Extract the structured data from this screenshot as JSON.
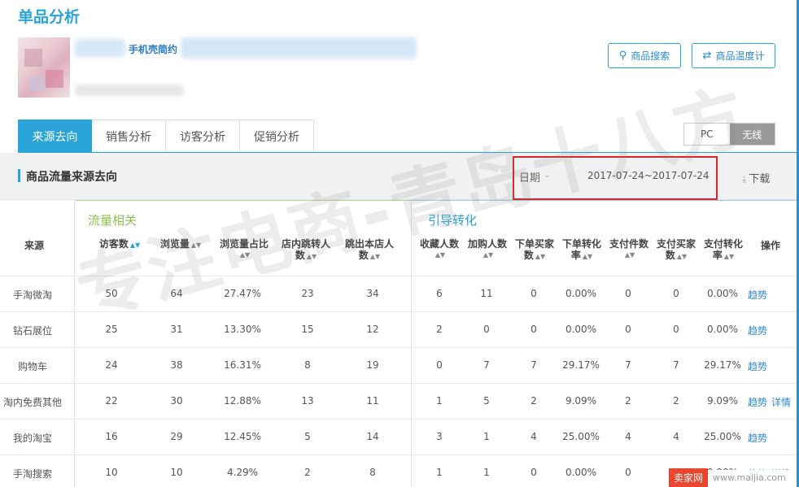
{
  "page": {
    "title": "单品分析"
  },
  "product": {
    "name": "手机壳简约"
  },
  "buttons": {
    "search": "商品搜索",
    "thermometer": "商品温度计"
  },
  "tabs": [
    "来源去向",
    "销售分析",
    "访客分析",
    "促销分析"
  ],
  "device_toggle": {
    "pc": "PC",
    "wireless": "无线"
  },
  "section": {
    "title": "商品流量来源去向",
    "date_label": "日期",
    "date_range": "2017-07-24~2017-07-24",
    "download": "下载"
  },
  "groups": {
    "traffic": "流量相关",
    "conversion": "引导转化"
  },
  "columns": {
    "source": "来源",
    "visitors": "访客数",
    "pageviews": "浏览量",
    "pv_ratio": "浏览量占比",
    "in_store_jump_a": "店内跳转人",
    "in_store_jump_b": "数",
    "exit_a": "跳出本店人",
    "exit_b": "数",
    "favorites": "收藏人数",
    "add_cart": "加购人数",
    "order_buyers_a": "下单买家",
    "order_buyers_b": "数",
    "order_conv_a": "下单转化",
    "order_conv_b": "率",
    "paid_items": "支付件数",
    "paid_buyers_a": "支付买家",
    "paid_buyers_b": "数",
    "paid_conv_a": "支付转化",
    "paid_conv_b": "率",
    "actions": "操作"
  },
  "rows": [
    {
      "source": "手淘微淘",
      "visitors": "50",
      "pageviews": "64",
      "pv_ratio": "27.47%",
      "jump": "23",
      "exit": "34",
      "fav": "6",
      "cart": "11",
      "order_buyers": "0",
      "order_conv": "0.00%",
      "paid_items": "0",
      "paid_buyers": "0",
      "paid_conv": "0.00%",
      "trend": "趋势",
      "detail": ""
    },
    {
      "source": "钻石展位",
      "visitors": "25",
      "pageviews": "31",
      "pv_ratio": "13.30%",
      "jump": "15",
      "exit": "12",
      "fav": "2",
      "cart": "0",
      "order_buyers": "0",
      "order_conv": "0.00%",
      "paid_items": "0",
      "paid_buyers": "0",
      "paid_conv": "0.00%",
      "trend": "趋势",
      "detail": ""
    },
    {
      "source": "购物车",
      "visitors": "24",
      "pageviews": "38",
      "pv_ratio": "16.31%",
      "jump": "8",
      "exit": "19",
      "fav": "0",
      "cart": "7",
      "order_buyers": "7",
      "order_conv": "29.17%",
      "paid_items": "7",
      "paid_buyers": "7",
      "paid_conv": "29.17%",
      "trend": "趋势",
      "detail": ""
    },
    {
      "source": "淘内免费其他",
      "visitors": "22",
      "pageviews": "30",
      "pv_ratio": "12.88%",
      "jump": "13",
      "exit": "11",
      "fav": "1",
      "cart": "5",
      "order_buyers": "2",
      "order_conv": "9.09%",
      "paid_items": "2",
      "paid_buyers": "2",
      "paid_conv": "9.09%",
      "trend": "趋势",
      "detail": "详情"
    },
    {
      "source": "我的淘宝",
      "visitors": "16",
      "pageviews": "29",
      "pv_ratio": "12.45%",
      "jump": "5",
      "exit": "14",
      "fav": "3",
      "cart": "1",
      "order_buyers": "4",
      "order_conv": "25.00%",
      "paid_items": "4",
      "paid_buyers": "4",
      "paid_conv": "25.00%",
      "trend": "趋势",
      "detail": ""
    },
    {
      "source": "手淘搜索",
      "visitors": "10",
      "pageviews": "10",
      "pv_ratio": "4.29%",
      "jump": "2",
      "exit": "8",
      "fav": "1",
      "cart": "1",
      "order_buyers": "0",
      "order_conv": "0.00%",
      "paid_items": "0",
      "paid_buyers": "0",
      "paid_conv": "0.00%",
      "trend": "趋势",
      "detail": "详情"
    }
  ],
  "watermark": "专注电商-青岛十八方",
  "site_badge": {
    "logo": "卖家网",
    "url": "www.maijia.com"
  },
  "colors": {
    "accent": "#2aa4d8",
    "traffic_group": "#8cc152",
    "highlight_box": "#d9262c"
  }
}
